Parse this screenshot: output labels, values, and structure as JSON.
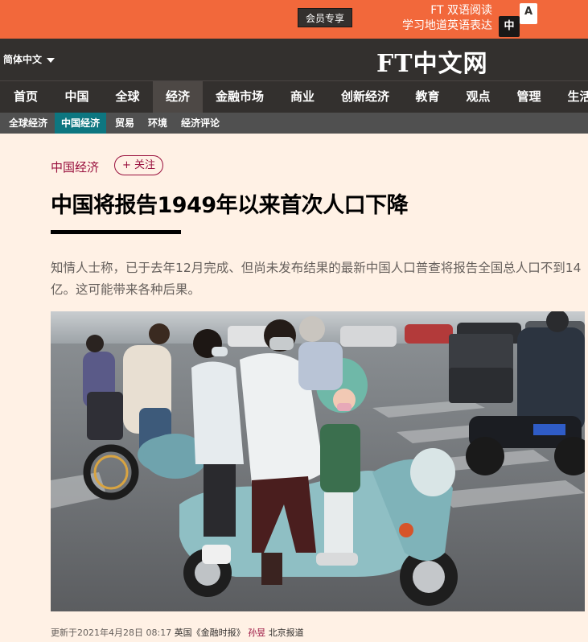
{
  "promo": {
    "member_button": "会员专享",
    "line1": "FT 双语阅读",
    "line2": "学习地道英语表达",
    "icon_top": "A",
    "icon_bottom": "中"
  },
  "masthead": {
    "language": "简体中文",
    "logo": "FT中文网"
  },
  "nav": {
    "items": [
      "首页",
      "中国",
      "全球",
      "经济",
      "金融市场",
      "商业",
      "创新经济",
      "教育",
      "观点",
      "管理",
      "生活"
    ],
    "active": "经济"
  },
  "subnav": {
    "items": [
      "全球经济",
      "中国经济",
      "贸易",
      "环境",
      "经济评论"
    ],
    "active": "中国经济"
  },
  "article": {
    "section": "中国经济",
    "follow_label": "+ 关注",
    "headline": "中国将报告1949年以来首次人口下降",
    "standfirst": "知情人士称，已于去年12月完成、但尚未发布结果的最新中国人口普查将报告全国总人口不到14亿。这可能带来各种后果。",
    "byline": {
      "date": "更新于2021年4月28日 08:17",
      "source": "英国《金融时报》",
      "author": "孙昱",
      "location": "北京报道"
    }
  },
  "colors": {
    "promo_bg": "#f2683b",
    "nav_bg": "#33302e",
    "subnav_active": "#0d7680",
    "claret": "#990f3d",
    "page_bg": "#fff1e5"
  }
}
